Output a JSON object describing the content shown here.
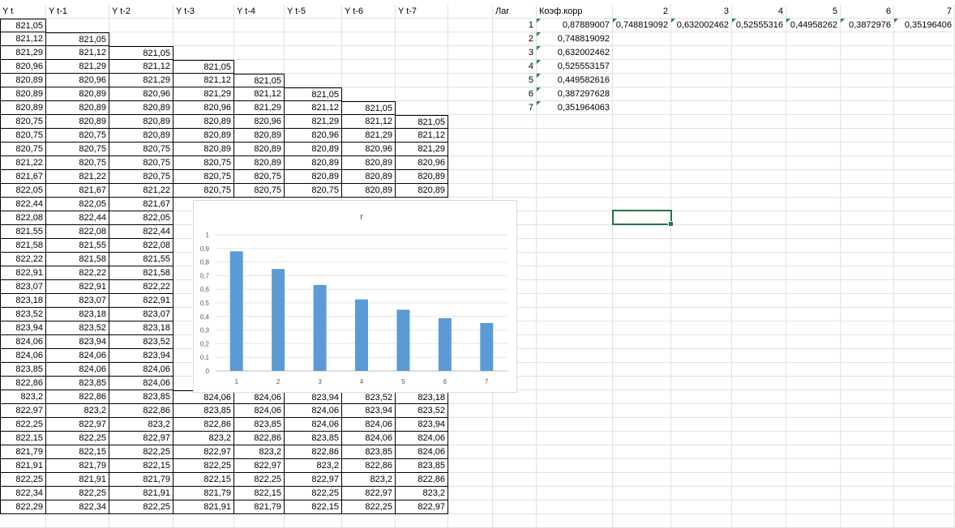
{
  "sheet": {
    "headers": [
      "Y t",
      "Y t-1",
      "Y t-2",
      "Y t-3",
      "Y t-4",
      "Y t-5",
      "Y t-6",
      "Y t-7"
    ],
    "table": [
      [
        "821,05",
        "",
        "",
        "",
        "",
        "",
        "",
        ""
      ],
      [
        "821,12",
        "821,05",
        "",
        "",
        "",
        "",
        "",
        ""
      ],
      [
        "821,29",
        "821,12",
        "821,05",
        "",
        "",
        "",
        "",
        ""
      ],
      [
        "820,96",
        "821,29",
        "821,12",
        "821,05",
        "",
        "",
        "",
        ""
      ],
      [
        "820,89",
        "820,96",
        "821,29",
        "821,12",
        "821,05",
        "",
        "",
        ""
      ],
      [
        "820,89",
        "820,89",
        "820,96",
        "821,29",
        "821,12",
        "821,05",
        "",
        ""
      ],
      [
        "820,89",
        "820,89",
        "820,89",
        "820,96",
        "821,29",
        "821,12",
        "821,05",
        ""
      ],
      [
        "820,75",
        "820,89",
        "820,89",
        "820,89",
        "820,96",
        "821,29",
        "821,12",
        "821,05"
      ],
      [
        "820,75",
        "820,75",
        "820,89",
        "820,89",
        "820,89",
        "820,96",
        "821,29",
        "821,12"
      ],
      [
        "820,75",
        "820,75",
        "820,75",
        "820,89",
        "820,89",
        "820,89",
        "820,96",
        "821,29"
      ],
      [
        "821,22",
        "820,75",
        "820,75",
        "820,75",
        "820,89",
        "820,89",
        "820,89",
        "820,96"
      ],
      [
        "821,67",
        "821,22",
        "820,75",
        "820,75",
        "820,75",
        "820,89",
        "820,89",
        "820,89"
      ],
      [
        "822,05",
        "821,67",
        "821,22",
        "820,75",
        "820,75",
        "820,75",
        "820,89",
        "820,89"
      ],
      [
        "822,44",
        "822,05",
        "821,67",
        "",
        "",
        "",
        "",
        ""
      ],
      [
        "822,08",
        "822,44",
        "822,05",
        "",
        "",
        "",
        "",
        ""
      ],
      [
        "821,55",
        "822,08",
        "822,44",
        "",
        "",
        "",
        "",
        ""
      ],
      [
        "821,58",
        "821,55",
        "822,08",
        "",
        "",
        "",
        "",
        ""
      ],
      [
        "822,22",
        "821,58",
        "821,55",
        "",
        "",
        "",
        "",
        ""
      ],
      [
        "822,91",
        "822,22",
        "821,58",
        "",
        "",
        "",
        "",
        ""
      ],
      [
        "823,07",
        "822,91",
        "822,22",
        "",
        "",
        "",
        "",
        ""
      ],
      [
        "823,18",
        "823,07",
        "822,91",
        "",
        "",
        "",
        "",
        ""
      ],
      [
        "823,52",
        "823,18",
        "823,07",
        "",
        "",
        "",
        "",
        ""
      ],
      [
        "823,94",
        "823,52",
        "823,18",
        "",
        "",
        "",
        "",
        ""
      ],
      [
        "824,06",
        "823,94",
        "823,52",
        "",
        "",
        "",
        "",
        ""
      ],
      [
        "824,06",
        "824,06",
        "823,94",
        "",
        "",
        "",
        "",
        ""
      ],
      [
        "823,85",
        "824,06",
        "824,06",
        "",
        "",
        "",
        "",
        ""
      ],
      [
        "822,86",
        "823,85",
        "824,06",
        "",
        "",
        "",
        "",
        ""
      ],
      [
        "823,2",
        "822,86",
        "823,85",
        "824,06",
        "824,06",
        "823,94",
        "823,52",
        "823,18"
      ],
      [
        "822,97",
        "823,2",
        "822,86",
        "823,85",
        "824,06",
        "824,06",
        "823,94",
        "823,52"
      ],
      [
        "822,25",
        "822,97",
        "823,2",
        "822,86",
        "823,85",
        "824,06",
        "824,06",
        "823,94"
      ],
      [
        "822,15",
        "822,25",
        "822,97",
        "823,2",
        "822,86",
        "823,85",
        "824,06",
        "824,06"
      ],
      [
        "821,79",
        "822,15",
        "822,25",
        "822,97",
        "823,2",
        "822,86",
        "823,85",
        "824,06"
      ],
      [
        "821,91",
        "821,79",
        "822,15",
        "822,25",
        "822,97",
        "823,2",
        "822,86",
        "823,85"
      ],
      [
        "822,25",
        "821,91",
        "821,79",
        "822,15",
        "822,25",
        "822,97",
        "823,2",
        "822,86"
      ],
      [
        "822,34",
        "822,25",
        "821,91",
        "821,79",
        "822,15",
        "822,25",
        "822,97",
        "823,2"
      ],
      [
        "822,29",
        "822,34",
        "822,25",
        "821,91",
        "821,79",
        "822,15",
        "822,25",
        "822,97"
      ]
    ]
  },
  "lag_table": {
    "lag_header": "Лаг",
    "coef_header": "Коэф.корр",
    "column_numbers": [
      "2",
      "3",
      "4",
      "5",
      "6",
      "7"
    ],
    "first_row_values": [
      "0,748819092",
      "0,632002462",
      "0,52555316",
      "0,44958262",
      "0,3872976",
      "0,35196406"
    ],
    "rows": [
      {
        "lag": "1",
        "coef": "0,87889007"
      },
      {
        "lag": "2",
        "coef": "0,748819092"
      },
      {
        "lag": "3",
        "coef": "0,632002462"
      },
      {
        "lag": "4",
        "coef": "0,525553157"
      },
      {
        "lag": "5",
        "coef": "0,449582616"
      },
      {
        "lag": "6",
        "coef": "0,387297628"
      },
      {
        "lag": "7",
        "coef": "0,351964063"
      }
    ]
  },
  "chart_data": {
    "type": "bar",
    "title": "r",
    "categories": [
      "1",
      "2",
      "3",
      "4",
      "5",
      "6",
      "7"
    ],
    "values": [
      0.87889007,
      0.748819092,
      0.632002462,
      0.525553157,
      0.449582616,
      0.387297628,
      0.351964063
    ],
    "y_ticks": [
      "0",
      "0,1",
      "0,2",
      "0,3",
      "0,4",
      "0,5",
      "0,6",
      "0,7",
      "0,8",
      "0,9",
      "1"
    ],
    "ylim": [
      0,
      1
    ],
    "grid": true,
    "bar_color": "#5b9bd5",
    "legend": "none"
  }
}
